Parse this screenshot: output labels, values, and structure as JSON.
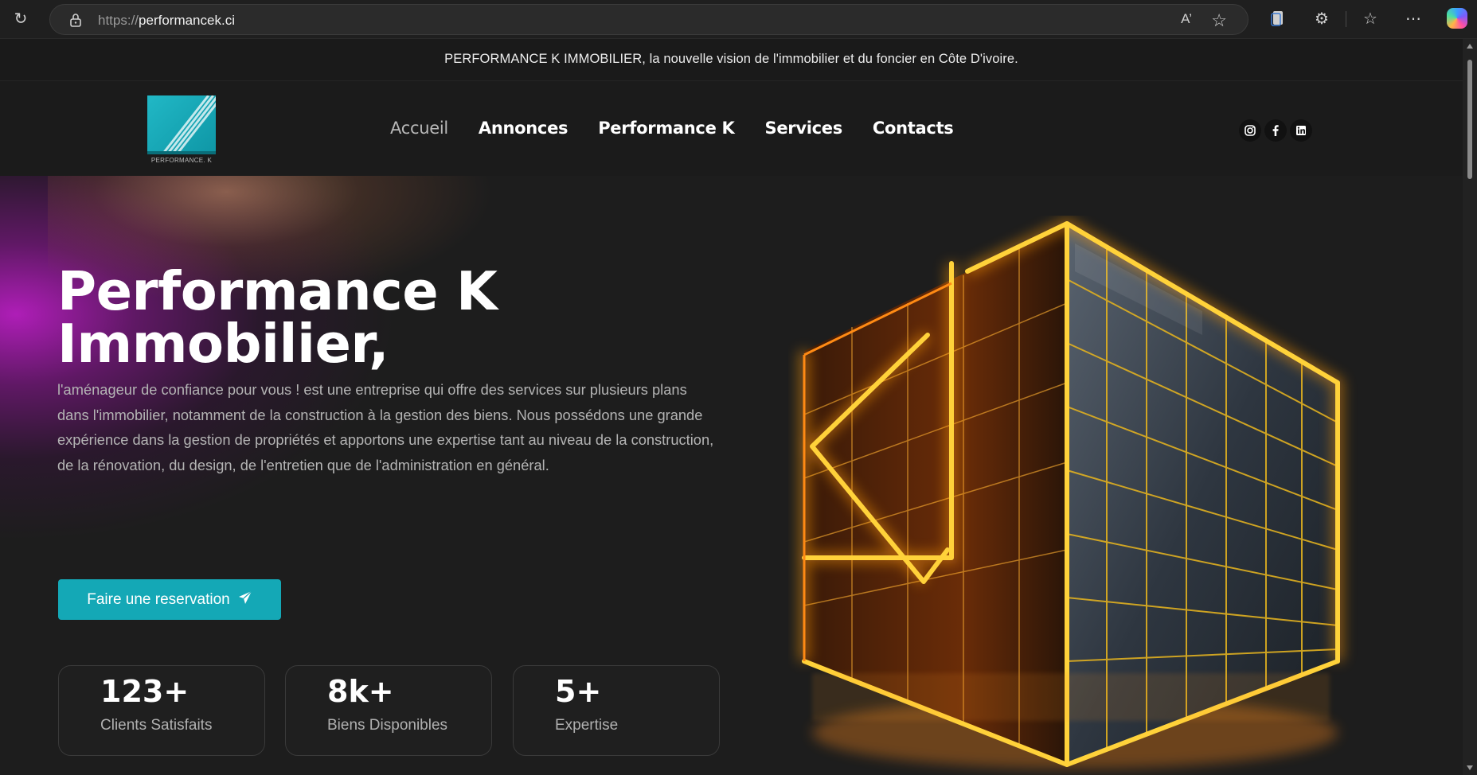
{
  "browser": {
    "url_protocol": "https://",
    "url_host": "performancek.ci",
    "read_aloud_icon": "A̷",
    "icons": [
      "reload-icon",
      "lock-icon",
      "read-aloud-icon",
      "favorite-star-icon",
      "copy-icon",
      "extensions-icon",
      "favorites-icon",
      "more-icon",
      "copilot-icon"
    ]
  },
  "announcement": "PERFORMANCE K IMMOBILIER, la nouvelle vision de l'immobilier et du foncier en Côte D'ivoire.",
  "logo": {
    "text": "PERFORMANCE. K"
  },
  "nav": {
    "items": [
      {
        "label": "Accueil",
        "active": true
      },
      {
        "label": "Annonces"
      },
      {
        "label": "Performance K"
      },
      {
        "label": "Services"
      },
      {
        "label": "Contacts"
      }
    ]
  },
  "social": [
    "instagram-icon",
    "facebook-icon",
    "linkedin-icon"
  ],
  "hero": {
    "title_line1": "Performance K",
    "title_line2": "Immobilier,",
    "description": "l'aménageur de confiance pour vous ! est une entreprise qui offre des services sur plusieurs plans dans l'immobilier, notamment de la construction à la gestion des biens. Nous possédons une grande expérience dans la gestion de propriétés et apportons une expertise tant au niveau de la construction, de la rénovation, du design, de l'entretien que de l'administration en général.",
    "cta_label": "Faire une reservation"
  },
  "stats": [
    {
      "value": "123+",
      "label": "Clients Satisfaits"
    },
    {
      "value": "8k+",
      "label": "Biens Disponibles"
    },
    {
      "value": "5+",
      "label": "Expertise"
    }
  ],
  "colors": {
    "accent": "#14a8b6",
    "background": "#1d1d1d",
    "neon": "#ffb21a"
  }
}
